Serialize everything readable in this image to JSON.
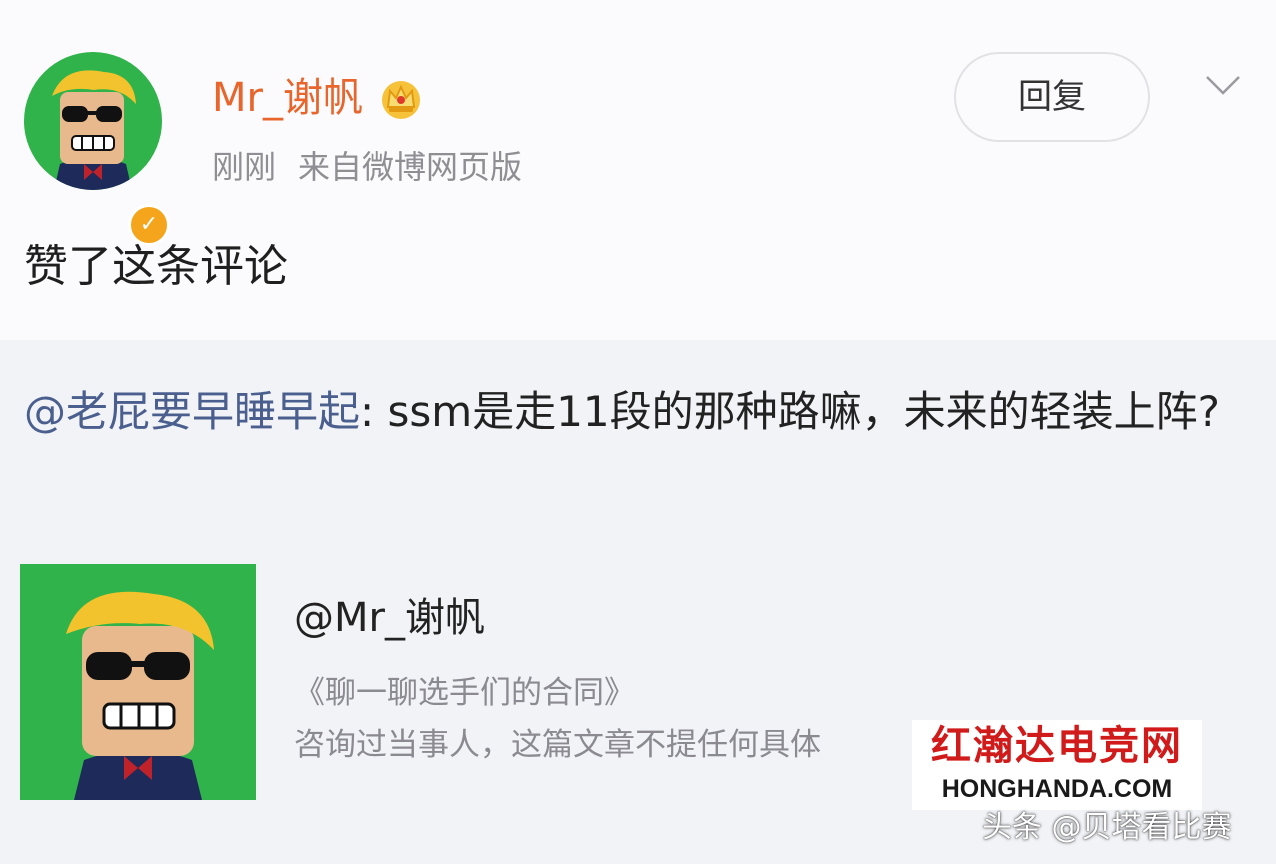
{
  "post": {
    "username": "Mr_谢帆",
    "timestamp": "刚刚",
    "source": "来自微博网页版",
    "reply_label": "回复",
    "action_text": "赞了这条评论",
    "icons": {
      "verified": "verified-badge-icon",
      "crown": "crown-icon",
      "menu": "chevron-down-icon"
    }
  },
  "quote": {
    "mention": "@老屁要早睡早起",
    "text": ": ssm是走11段的那种路嘛，未来的轻装上阵?"
  },
  "article": {
    "author": "@Mr_谢帆",
    "title": "《聊一聊选手们的合同》",
    "description": "咨询过当事人，这篇文章不提任何具体"
  },
  "watermarks": {
    "site_cn": "红瀚达电竞网",
    "site_en": "HONGHANDA.COM",
    "source": "头条 @贝塔看比赛"
  },
  "colors": {
    "username": "#e8652c",
    "mention": "#4a5f8e",
    "meta": "#8e8e93",
    "verified": "#f4a51c",
    "watermark_red": "#d11b1b"
  }
}
